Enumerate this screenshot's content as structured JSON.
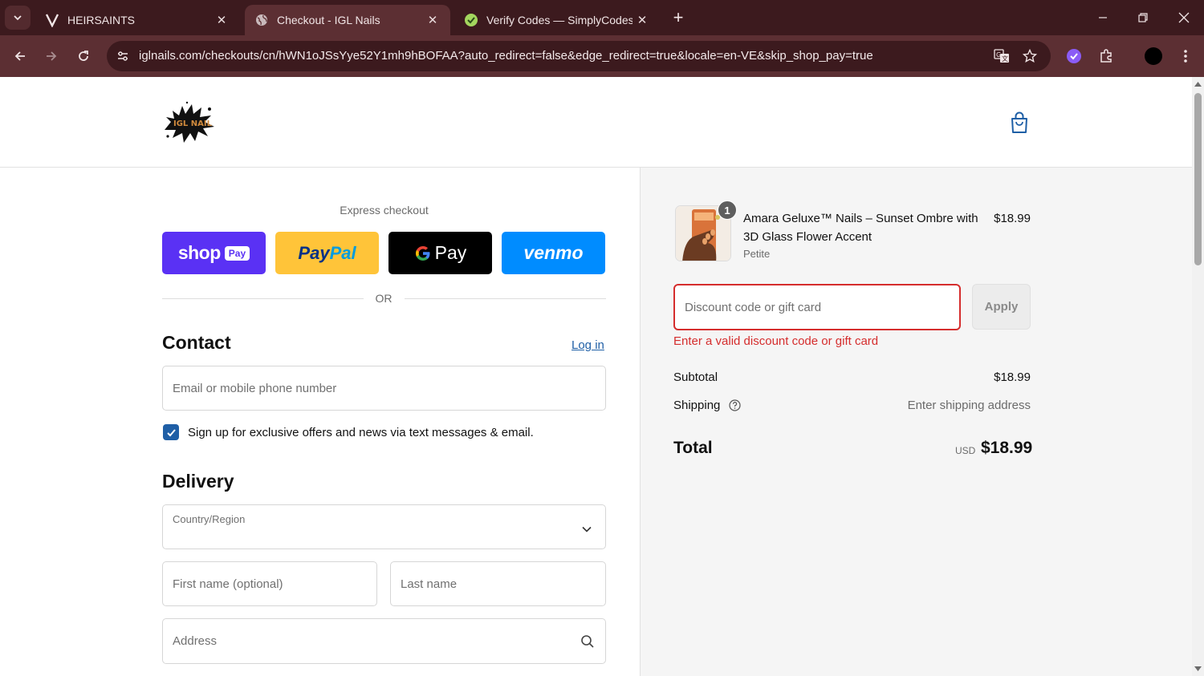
{
  "browser": {
    "tabs": [
      {
        "title": "HEIRSAINTS",
        "icon": "v-logo-icon"
      },
      {
        "title": "Checkout - IGL Nails",
        "icon": "globe-icon"
      },
      {
        "title": "Verify Codes — SimplyCodes",
        "icon": "simplycodes-check-icon"
      }
    ],
    "url": "iglnails.com/checkouts/cn/hWN1oJSsYye52Y1mh9hBOFAA?auto_redirect=false&edge_redirect=true&locale=en-VE&skip_shop_pay=true"
  },
  "express": {
    "title": "Express checkout",
    "shop_pay": "shop",
    "shop_pay_tag": "Pay",
    "paypal_pay": "Pay",
    "paypal_pal": "Pal",
    "gpay": "Pay",
    "venmo": "venmo",
    "or": "OR"
  },
  "contact": {
    "heading": "Contact",
    "login": "Log in",
    "email_placeholder": "Email or mobile phone number",
    "signup_label": "Sign up for exclusive offers and news via text messages & email.",
    "signup_checked": true
  },
  "delivery": {
    "heading": "Delivery",
    "country_label": "Country/Region",
    "first_name_placeholder": "First name (optional)",
    "last_name_placeholder": "Last name",
    "address_placeholder": "Address"
  },
  "summary": {
    "product": {
      "title": "Amara Geluxe™ Nails – Sunset Ombre with 3D Glass Flower Accent",
      "variant": "Petite",
      "price": "$18.99",
      "quantity": "1"
    },
    "discount_placeholder": "Discount code or gift card",
    "apply": "Apply",
    "error": "Enter a valid discount code or gift card",
    "subtotal_label": "Subtotal",
    "subtotal_value": "$18.99",
    "shipping_label": "Shipping",
    "shipping_value": "Enter shipping address",
    "total_label": "Total",
    "currency": "USD",
    "total_value": "$18.99"
  },
  "colors": {
    "browser_dark": "#3c1a1e",
    "browser_toolbar": "#5c2f33",
    "shop_pay": "#5a31f4",
    "paypal": "#ffc439",
    "gpay": "#000000",
    "venmo": "#008cff",
    "link": "#1f5fa6",
    "error": "#d52d2d"
  }
}
